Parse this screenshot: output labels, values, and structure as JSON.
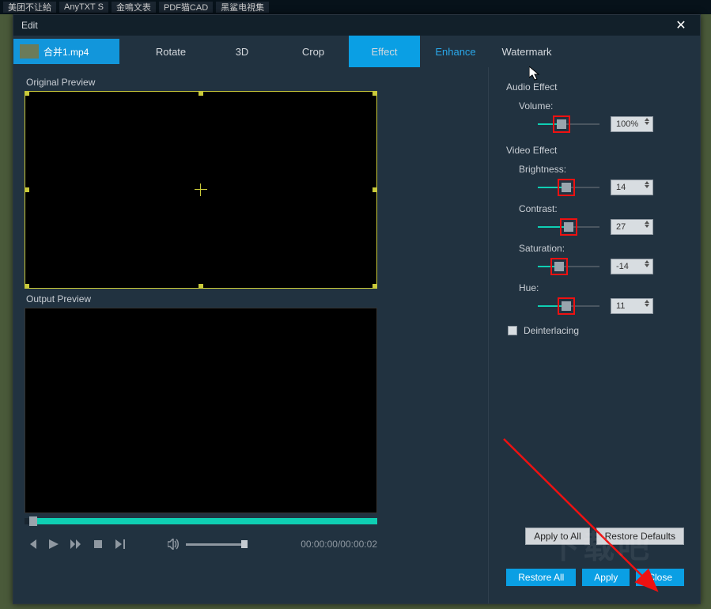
{
  "bgTabs": [
    {
      "label": "美团不让給",
      "color": "#f5c518"
    },
    {
      "label": "AnyTXT S",
      "color": "#2aa8ea"
    },
    {
      "label": "金鳴文表",
      "color": "#2aa8ea"
    },
    {
      "label": "PDF猫CAD",
      "color": "#e03030"
    },
    {
      "label": "黑鲨电視集",
      "color": "#aaa"
    }
  ],
  "title": "Edit",
  "file": "合并1.mp4",
  "tabs": [
    "Rotate",
    "3D",
    "Crop",
    "Effect",
    "Enhance",
    "Watermark"
  ],
  "activeTab": 3,
  "linkTab": 4,
  "labels": {
    "orig": "Original Preview",
    "out": "Output Preview",
    "audioEffect": "Audio Effect",
    "videoEffect": "Video Effect",
    "deint": "Deinterlacing"
  },
  "time": "00:00:00/00:00:02",
  "sliders": {
    "volume": {
      "label": "Volume:",
      "value": "100%",
      "pct": 38
    },
    "brightness": {
      "label": "Brightness:",
      "value": "14",
      "pct": 46
    },
    "contrast": {
      "label": "Contrast:",
      "value": "27",
      "pct": 50
    },
    "saturation": {
      "label": "Saturation:",
      "value": "-14",
      "pct": 34
    },
    "hue": {
      "label": "Hue:",
      "value": "11",
      "pct": 46
    }
  },
  "buttons": {
    "applyAll": "Apply to All",
    "restoreDef": "Restore Defaults",
    "restoreAll": "Restore All",
    "apply": "Apply",
    "close": "Close"
  }
}
